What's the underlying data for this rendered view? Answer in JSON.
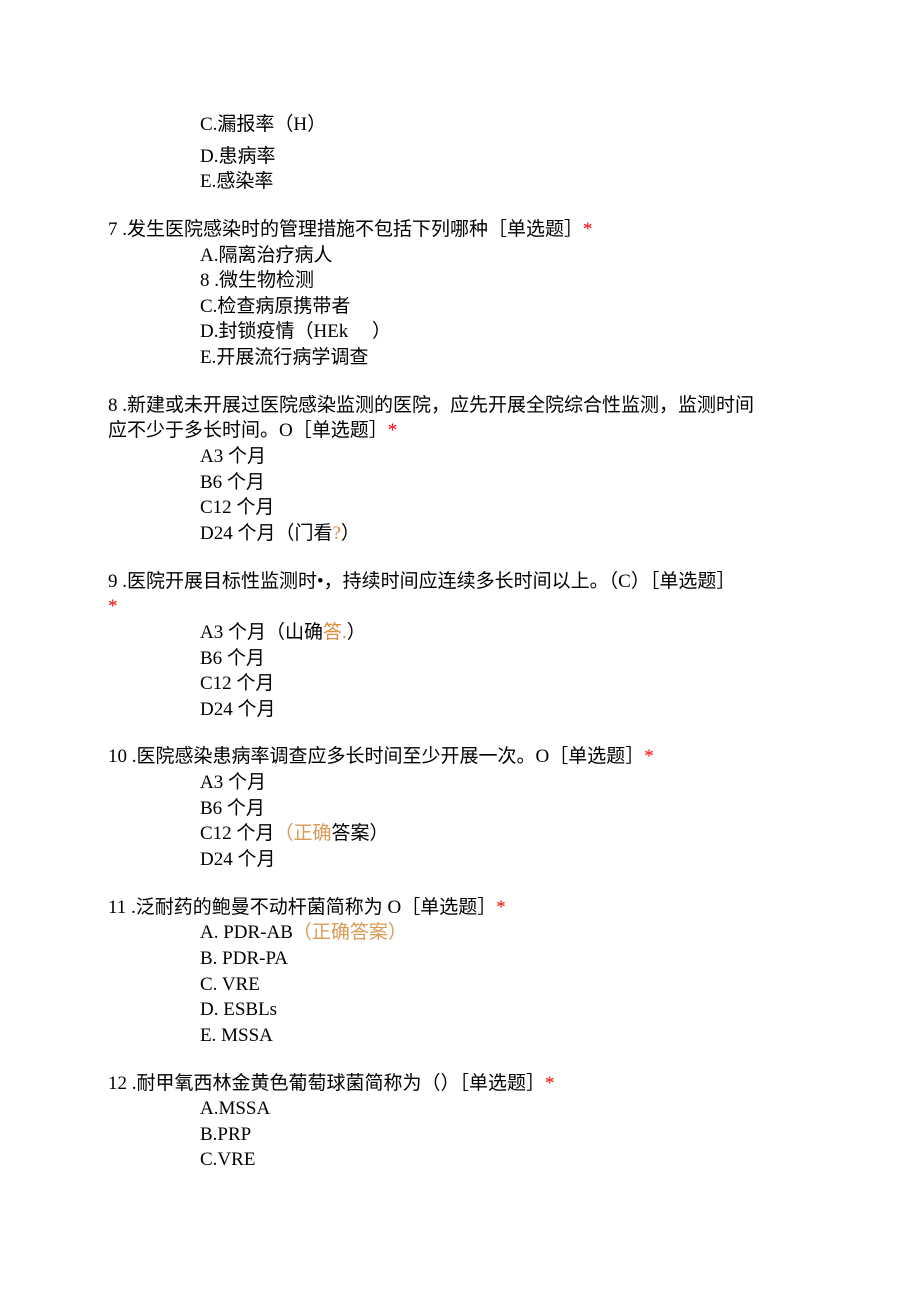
{
  "prelude": {
    "optC": "C.漏报率（H）",
    "optD": "D.患病率",
    "optE": "E.感染率"
  },
  "q7": {
    "stem_pre": "7 .发生医院感染时的管理措施不包括下列哪种［单选题］",
    "star": "*",
    "a": "A.隔离治疗病人",
    "b": "8 .微生物检测",
    "c": "C.检查病原携带者",
    "d": "D.封锁疫情（HEk　 ）",
    "e": "E.开展流行病学调查"
  },
  "q8": {
    "stem1_pre": "8 .新建或未开展过医院感染监测的医院，应先开展全院综合性监测，监测时间",
    "stem2_pre": "应不少于多长时间。O［单选题］",
    "star": "*",
    "a": "A3 个月",
    "b": "B6 个月",
    "c": "C12 个月",
    "d_pre": "D24 个月（门看",
    "d_orange": "?",
    "d_post": "）"
  },
  "q9": {
    "stem1": "9 .医院开展目标性监测时•，持续时间应连续多长时间以上。（C）［单选题］",
    "star": "*",
    "a_pre": "A3 个月（山确",
    "a_orange": "答.",
    "a_post": "）",
    "b": "B6 个月",
    "c": "C12 个月",
    "d": "D24 个月"
  },
  "q10": {
    "stem_pre": "10 .医院感染患病率调查应多长时间至少开展一次。O［单选题］",
    "star": "*",
    "a": "A3 个月",
    "b": "B6 个月",
    "c_pre": "C12 个月",
    "c_orange": "（正确",
    "c_post": "答案）",
    "d": "D24 个月"
  },
  "q11": {
    "stem_pre": "11 .泛耐药的鲍曼不动杆菌简称为 O［单选题］",
    "star": "*",
    "a_pre": "A.  PDR-AB",
    "a_orange": "（正确答案）",
    "b": "B.  PDR-PA",
    "c": "C.  VRE",
    "d": "D.  ESBLs",
    "e": "E.  MSSA"
  },
  "q12": {
    "stem_pre": "12 .耐甲氧西林金黄色葡萄球菌简称为（）［单选题］",
    "star": "*",
    "a": "A.MSSA",
    "b": "B.PRP",
    "c": "C.VRE"
  }
}
